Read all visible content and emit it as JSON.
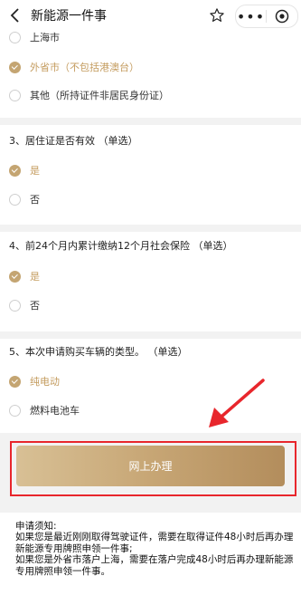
{
  "header": {
    "title": "新能源一件事"
  },
  "q_prev": {
    "options": [
      {
        "label": "上海市",
        "checked": false
      },
      {
        "label": "外省市（不包括港澳台）",
        "checked": true
      },
      {
        "label": "其他（所持证件非居民身份证）",
        "checked": false
      }
    ]
  },
  "q3": {
    "title": "3、居住证是否有效 （单选）",
    "options": [
      {
        "label": "是",
        "checked": true
      },
      {
        "label": "否",
        "checked": false
      }
    ]
  },
  "q4": {
    "title": "4、前24个月内累计缴纳12个月社会保险 （单选）",
    "options": [
      {
        "label": "是",
        "checked": true
      },
      {
        "label": "否",
        "checked": false
      }
    ]
  },
  "q5": {
    "title": "5、本次申请购买车辆的类型。 （单选）",
    "options": [
      {
        "label": "纯电动",
        "checked": true
      },
      {
        "label": "燃料电池车",
        "checked": false
      }
    ]
  },
  "submit": {
    "label": "网上办理"
  },
  "notice": {
    "heading": "申请须知:",
    "line1": "如果您是最近刚刚取得驾驶证件，需要在取得证件48小时后再办理新能源专用牌照申领一件事;",
    "line2": "如果您是外省市落户上海，需要在落户完成48小时后再办理新能源专用牌照申领一件事。"
  },
  "colors": {
    "accent": "#c4a572",
    "highlight": "#e8262c"
  }
}
